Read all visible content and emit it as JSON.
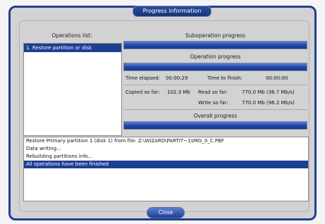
{
  "window": {
    "title": "Progress information"
  },
  "operations_list": {
    "header": "Operations list:",
    "items": [
      "1. Restore partition or disk"
    ]
  },
  "suboperation": {
    "label": "Suboperation progress",
    "progress_fraction": 1.0
  },
  "operation": {
    "label": "Operation progress",
    "progress_fraction": 1.0
  },
  "stats": {
    "time_elapsed_label": "Time elapsed:",
    "time_elapsed_value": "00:00:29",
    "time_to_finish_label": "Time to finish:",
    "time_to_finish_value": "00:00:00",
    "copied_label": "Copied so far:",
    "copied_value": "102.3 Mb",
    "read_label": "Read so far:",
    "read_value": "770.0 Mb (36.7 Mb/s)",
    "write_label": "Write so far:",
    "write_value": "770.0 Mb (96.2 Mb/s)"
  },
  "overall": {
    "label": "Overall progress",
    "progress_fraction": 1.0
  },
  "log": {
    "lines": [
      "Restore Primary partition 1 (disk 1) from file: Z:\\WIZARD\\PARTIT~1\\IMG_0_C.PBF",
      "Data writing...",
      "Rebuilding partitions info...",
      "All operations have been finished"
    ],
    "selected_index": 3
  },
  "close_button": {
    "label": "Close"
  }
}
